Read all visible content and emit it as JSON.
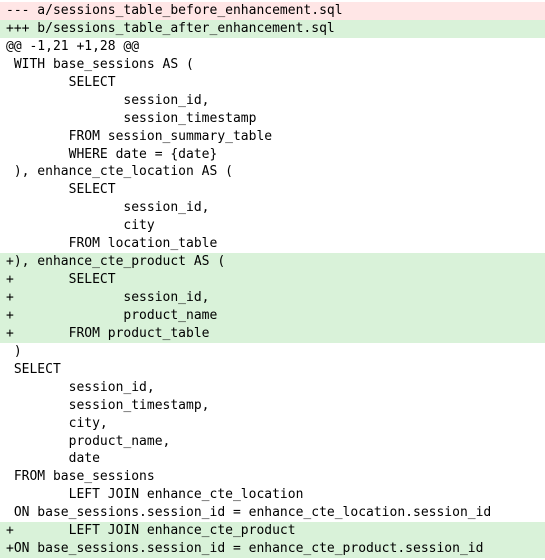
{
  "diff": {
    "from_file": "--- a/sessions_table_before_enhancement.sql",
    "to_file": "+++ b/sessions_table_after_enhancement.sql",
    "hunk_header": "@@ -1,21 +1,28 @@",
    "lines": [
      {
        "type": "context",
        "text": " WITH base_sessions AS ("
      },
      {
        "type": "context",
        "text": "        SELECT"
      },
      {
        "type": "context",
        "text": "               session_id,"
      },
      {
        "type": "context",
        "text": "               session_timestamp"
      },
      {
        "type": "context",
        "text": "        FROM session_summary_table"
      },
      {
        "type": "context",
        "text": "        WHERE date = {date}"
      },
      {
        "type": "context",
        "text": " ), enhance_cte_location AS ("
      },
      {
        "type": "context",
        "text": "        SELECT"
      },
      {
        "type": "context",
        "text": "               session_id,"
      },
      {
        "type": "context",
        "text": "               city"
      },
      {
        "type": "context",
        "text": "        FROM location_table"
      },
      {
        "type": "added",
        "text": "+), enhance_cte_product AS ("
      },
      {
        "type": "added",
        "text": "+       SELECT"
      },
      {
        "type": "added",
        "text": "+              session_id,"
      },
      {
        "type": "added",
        "text": "+              product_name"
      },
      {
        "type": "added",
        "text": "+       FROM product_table"
      },
      {
        "type": "context",
        "text": " )"
      },
      {
        "type": "context",
        "text": " SELECT"
      },
      {
        "type": "context",
        "text": "        session_id,"
      },
      {
        "type": "context",
        "text": "        session_timestamp,"
      },
      {
        "type": "context",
        "text": "        city,"
      },
      {
        "type": "context",
        "text": "        product_name,"
      },
      {
        "type": "context",
        "text": "        date"
      },
      {
        "type": "context",
        "text": " FROM base_sessions"
      },
      {
        "type": "context",
        "text": "        LEFT JOIN enhance_cte_location"
      },
      {
        "type": "context",
        "text": " ON base_sessions.session_id = enhance_cte_location.session_id"
      },
      {
        "type": "added",
        "text": "+       LEFT JOIN enhance_cte_product"
      },
      {
        "type": "added",
        "text": "+ON base_sessions.session_id = enhance_cte_product.session_id"
      }
    ]
  }
}
